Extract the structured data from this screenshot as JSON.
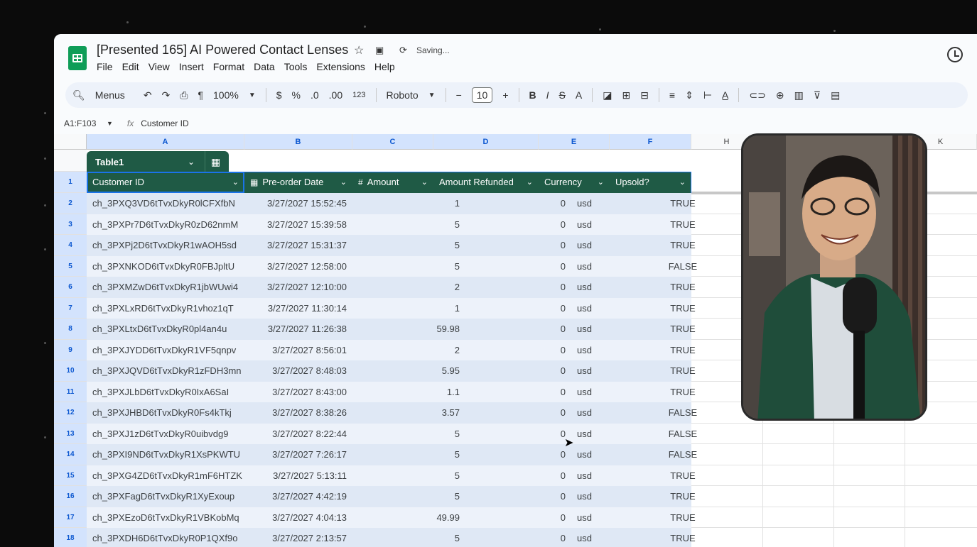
{
  "doc": {
    "title": "[Presented 165] AI Powered Contact Lenses",
    "saving_status": "Saving..."
  },
  "menu": [
    "File",
    "Edit",
    "View",
    "Insert",
    "Format",
    "Data",
    "Tools",
    "Extensions",
    "Help"
  ],
  "toolbar": {
    "menus_label": "Menus",
    "zoom": "100%",
    "currency": "$",
    "percent": "%",
    "decrease_decimal": ".0",
    "increase_decimal": ".00",
    "number_format": "123",
    "font": "Roboto",
    "font_size": "10",
    "minus": "−",
    "plus": "+",
    "bold": "B",
    "italic": "I",
    "text_color": "A"
  },
  "formula_bar": {
    "range": "A1:F103",
    "fx": "fx",
    "content": "Customer ID"
  },
  "columns": [
    "A",
    "B",
    "C",
    "D",
    "E",
    "F",
    "H",
    "K"
  ],
  "table": {
    "name": "Table1",
    "headers": [
      "Customer ID",
      "Pre-order Date",
      "Amount",
      "Amount Refunded",
      "Currency",
      "Upsold?"
    ],
    "rows": [
      [
        "ch_3PXQ3VD6tTvxDkyR0lCFXfbN",
        "3/27/2027 15:52:45",
        "1",
        "0",
        "usd",
        "TRUE"
      ],
      [
        "ch_3PXPr7D6tTvxDkyR0zD62nmM",
        "3/27/2027 15:39:58",
        "5",
        "0",
        "usd",
        "TRUE"
      ],
      [
        "ch_3PXPj2D6tTvxDkyR1wAOH5sd",
        "3/27/2027 15:31:37",
        "5",
        "0",
        "usd",
        "TRUE"
      ],
      [
        "ch_3PXNKOD6tTvxDkyR0FBJpltU",
        "3/27/2027 12:58:00",
        "5",
        "0",
        "usd",
        "FALSE"
      ],
      [
        "ch_3PXMZwD6tTvxDkyR1jbWUwi4",
        "3/27/2027 12:10:00",
        "2",
        "0",
        "usd",
        "TRUE"
      ],
      [
        "ch_3PXLxRD6tTvxDkyR1vhoz1qT",
        "3/27/2027 11:30:14",
        "1",
        "0",
        "usd",
        "TRUE"
      ],
      [
        "ch_3PXLtxD6tTvxDkyR0pl4an4u",
        "3/27/2027 11:26:38",
        "59.98",
        "0",
        "usd",
        "TRUE"
      ],
      [
        "ch_3PXJYDD6tTvxDkyR1VF5qnpv",
        "3/27/2027 8:56:01",
        "2",
        "0",
        "usd",
        "TRUE"
      ],
      [
        "ch_3PXJQVD6tTvxDkyR1zFDH3mn",
        "3/27/2027 8:48:03",
        "5.95",
        "0",
        "usd",
        "TRUE"
      ],
      [
        "ch_3PXJLbD6tTvxDkyR0IxA6SaI",
        "3/27/2027 8:43:00",
        "1.1",
        "0",
        "usd",
        "TRUE"
      ],
      [
        "ch_3PXJHBD6tTvxDkyR0Fs4kTkj",
        "3/27/2027 8:38:26",
        "3.57",
        "0",
        "usd",
        "FALSE"
      ],
      [
        "ch_3PXJ1zD6tTvxDkyR0uibvdg9",
        "3/27/2027 8:22:44",
        "5",
        "0",
        "usd",
        "FALSE"
      ],
      [
        "ch_3PXI9ND6tTvxDkyR1XsPKWTU",
        "3/27/2027 7:26:17",
        "5",
        "0",
        "usd",
        "FALSE"
      ],
      [
        "ch_3PXG4ZD6tTvxDkyR1mF6HTZK",
        "3/27/2027 5:13:11",
        "5",
        "0",
        "usd",
        "TRUE"
      ],
      [
        "ch_3PXFagD6tTvxDkyR1XyExoup",
        "3/27/2027 4:42:19",
        "5",
        "0",
        "usd",
        "TRUE"
      ],
      [
        "ch_3PXEzoD6tTvxDkyR1VBKobMq",
        "3/27/2027 4:04:13",
        "49.99",
        "0",
        "usd",
        "TRUE"
      ],
      [
        "ch_3PXDH6D6tTvxDkyR0P1QXf9o",
        "3/27/2027 2:13:57",
        "5",
        "0",
        "usd",
        "TRUE"
      ]
    ]
  },
  "row_numbers": [
    "1",
    "2",
    "3",
    "4",
    "5",
    "6",
    "7",
    "8",
    "9",
    "10",
    "11",
    "12",
    "13",
    "14",
    "15",
    "16",
    "17",
    "18"
  ],
  "colors": {
    "table_header": "#1f5a45",
    "selection": "#1a73e8",
    "band_odd": "#dfe8f5",
    "band_even": "#edf2fa"
  }
}
